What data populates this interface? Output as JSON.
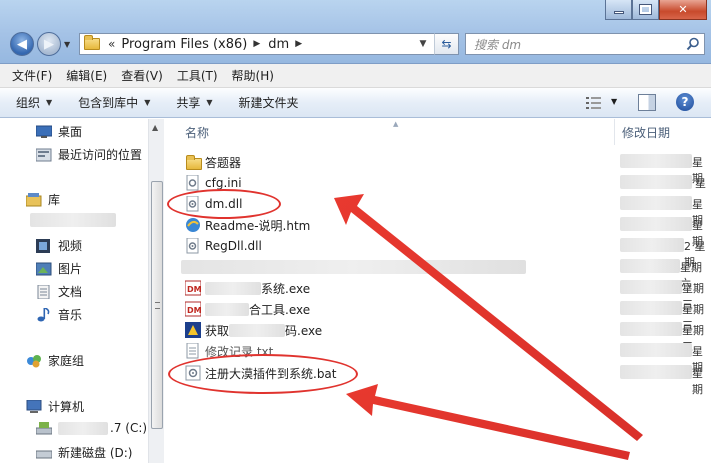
{
  "address": {
    "chevron": "«",
    "segments": [
      "Program Files (x86)",
      "dm"
    ]
  },
  "search": {
    "placeholder": "搜索 dm"
  },
  "menu": [
    "文件(F)",
    "编辑(E)",
    "查看(V)",
    "工具(T)",
    "帮助(H)"
  ],
  "commands": [
    {
      "label": "组织",
      "dropdown": true
    },
    {
      "label": "包含到库中",
      "dropdown": true
    },
    {
      "label": "共享",
      "dropdown": true
    },
    {
      "label": "新建文件夹",
      "dropdown": false
    }
  ],
  "nav": {
    "favorites": [
      "桌面",
      "最近访问的位置"
    ],
    "libraries_label": "库",
    "libraries": [
      "视频",
      "图片",
      "文档",
      "音乐"
    ],
    "homegroup": "家庭组",
    "computer": "计算机",
    "drive_c_suffix": ".7 (C:)",
    "drive_d": "新建磁盘 (D:)"
  },
  "columns": {
    "name": "名称",
    "modified": "修改日期"
  },
  "files": [
    {
      "name": "答题器",
      "type": "folder",
      "date_text": "星期"
    },
    {
      "name": "cfg.ini",
      "type": "ini",
      "date_text": "星"
    },
    {
      "name": "dm.dll",
      "type": "dll",
      "date_text": "星期"
    },
    {
      "name": "Readme-说明.htm",
      "type": "htm",
      "date_text": "星期"
    },
    {
      "name": "RegDll.dll",
      "type": "dll",
      "date_text": "2 星期"
    },
    {
      "name": "",
      "type": "blurred",
      "date_text": "星期六"
    },
    {
      "name": "系统.exe",
      "type": "dm-exe",
      "date_text": "星期三"
    },
    {
      "name": "合工具.exe",
      "type": "dm-exe",
      "date_text": "星期三"
    },
    {
      "name": "获取",
      "name_suffix": "码.exe",
      "type": "exe",
      "date_text": "星期三"
    },
    {
      "name": "修改记录.txt",
      "type": "txt",
      "date_text": "星期"
    },
    {
      "name": "注册大漠插件到系统.bat",
      "type": "bat",
      "date_text": "星期"
    }
  ],
  "colors": {
    "accent": "#e0332e",
    "nav_selected": "#3467b0"
  }
}
